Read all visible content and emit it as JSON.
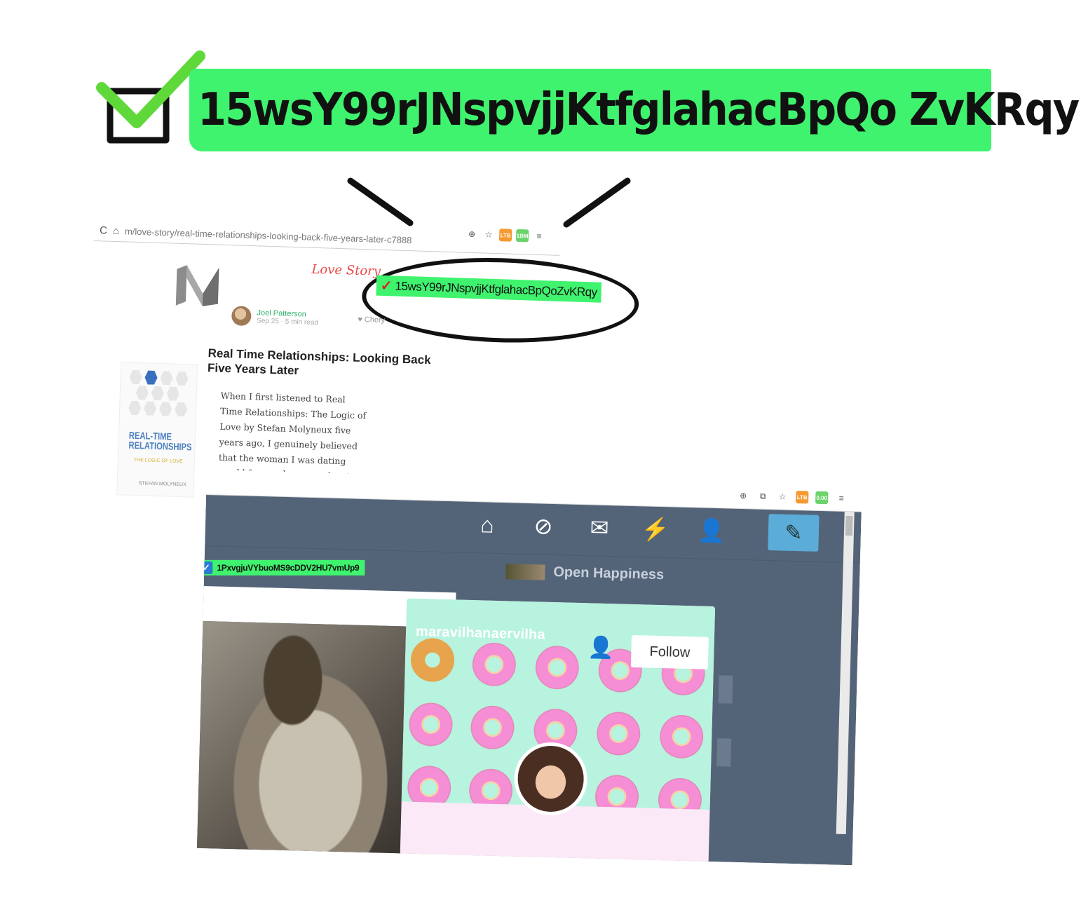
{
  "banner": {
    "address": "15wsY99rJNspvjjKtfglahacBpQo ZvKRqy"
  },
  "blog": {
    "url": "m/love-story/real-time-relationships-looking-back-five-years-later-c7888",
    "publication": "Love Story",
    "address_chip": "15wsY99rJNspvjjKtfglahacBpQoZvKRqy",
    "author": "Joel Patterson",
    "meta": "Sep 25 · 5 min read",
    "recommender": "Chery",
    "title": "Real Time Relationships: Looking Back Five Years Later",
    "body": "When I first listened to Real Time Relationships: The Logic of Love by Stefan Molyneux five years ago, I genuinely believed that the woman I was dating would forever be my soul mate and that the bond I shared with her was true love. Having picked up the book with the hope to make an already enjoyable",
    "book": {
      "title": "REAL-TIME RELATIONSHIPS",
      "subtitle": "THE LOGIC OF LOVE",
      "author": "STEFAN MOLYNEUX"
    },
    "ext_badges": [
      "LTB",
      "1BM"
    ]
  },
  "dashboard": {
    "address_chip": "1PxvgjuVYbuoMS9cDDV2HU7vmUp9",
    "open_happiness": "Open Happiness",
    "blog_name": "maravilhanaervilha",
    "follow_label": "Follow",
    "ext_badges": [
      "LTB",
      "0.00"
    ],
    "colors": {
      "dashboard_bg": "#546478",
      "compose": "#5bacd9",
      "highlight": "#3ff36e"
    }
  }
}
